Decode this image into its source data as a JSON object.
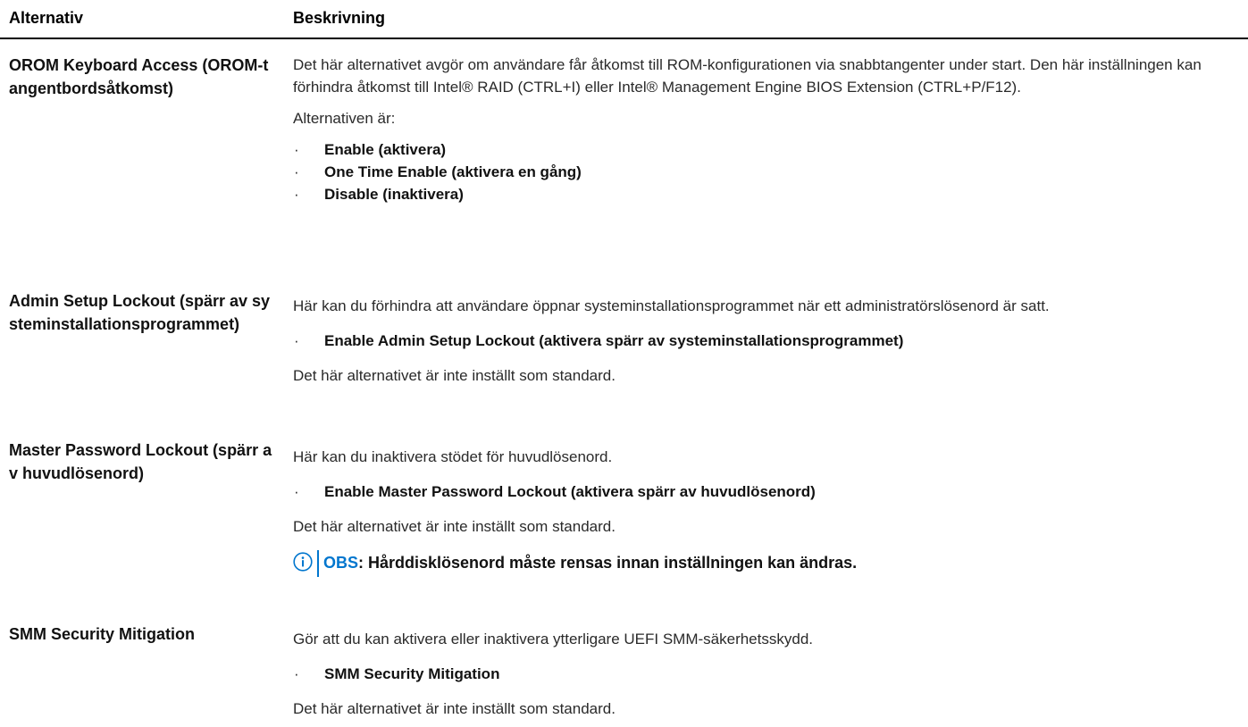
{
  "header": {
    "col_option": "Alternativ",
    "col_description": "Beskrivning"
  },
  "rows": [
    {
      "name": "OROM Keyboard Access (OROM-tangentbordsåtkomst)",
      "description": "Det här alternativet avgör om användare får åtkomst till ROM-konfigurationen via snabbtangenter under start. Den här inställningen kan förhindra åtkomst till Intel® RAID (CTRL+I) eller Intel® Management Engine BIOS Extension (CTRL+P/F12).",
      "options_intro": "Alternativen är:",
      "bullets": [
        "Enable (aktivera)",
        "One Time Enable (aktivera en gång)",
        "Disable (inaktivera)"
      ]
    },
    {
      "name": "Admin Setup Lockout (spärr av systeminstallationsprogrammet)",
      "description": "Här kan du förhindra att användare öppnar systeminstallationsprogrammet när ett administratörslösenord är satt.",
      "bullets": [
        "Enable Admin Setup Lockout (aktivera spärr av systeminstallationsprogrammet)"
      ],
      "default_note": "Det här alternativet är inte inställt som standard."
    },
    {
      "name": "Master Password Lockout (spärr av huvudlösenord)",
      "description": "Här kan du inaktivera stödet för huvudlösenord.",
      "bullets": [
        "Enable Master Password Lockout (aktivera spärr av huvudlösenord)"
      ],
      "default_note": "Det här alternativet är inte inställt som standard.",
      "note": {
        "label": "OBS",
        "text": ": Hårddisklösenord måste rensas innan inställningen kan ändras."
      }
    },
    {
      "name": "SMM Security Mitigation",
      "description": "Gör att du kan aktivera eller inaktivera ytterligare UEFI SMM-säkerhetsskydd.",
      "bullets": [
        "SMM Security Mitigation"
      ],
      "default_note": "Det här alternativet är inte inställt som standard."
    }
  ],
  "bullet_glyph": "·",
  "colors": {
    "accent": "#0076ce",
    "text": "#2a2a2a",
    "rule": "#000000"
  },
  "icons": {
    "note_icon": "info-icon"
  }
}
